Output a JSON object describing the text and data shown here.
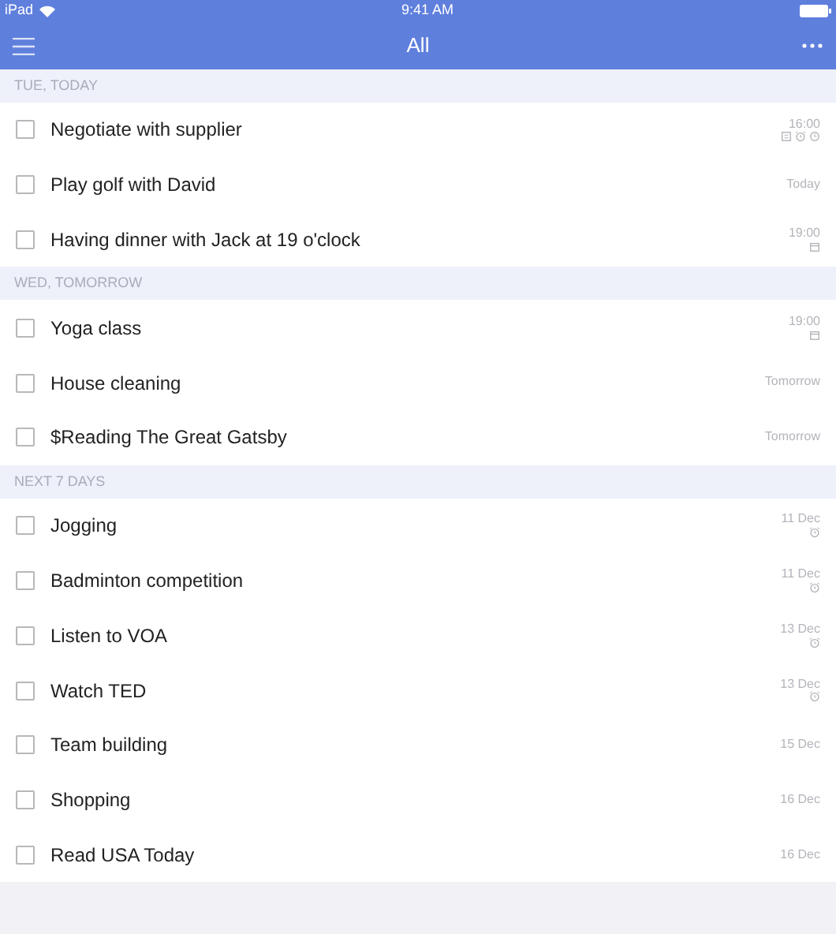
{
  "status_bar": {
    "device": "iPad",
    "time": "9:41 AM"
  },
  "nav": {
    "title": "All"
  },
  "sections": [
    {
      "header": "TUE, TODAY",
      "tasks": [
        {
          "title": "Negotiate with supplier",
          "checked": false,
          "due": "16:00",
          "icons": [
            {
              "kind": "note"
            },
            {
              "kind": "alarm"
            },
            {
              "kind": "clock"
            }
          ]
        },
        {
          "title": "Play golf with David",
          "checked": false,
          "due": "Today"
        },
        {
          "title": "Having dinner with Jack at 19 o'clock",
          "checked": false,
          "due": "19:00",
          "icons": [
            {
              "kind": "calendar"
            }
          ]
        }
      ]
    },
    {
      "header": "WED, TOMORROW",
      "tasks": [
        {
          "title": "Yoga class",
          "checked": false,
          "due": "19:00",
          "icons": [
            {
              "kind": "calendar"
            }
          ]
        },
        {
          "title": "House cleaning",
          "checked": false,
          "due": "Tomorrow"
        },
        {
          "title": "$Reading The Great Gatsby",
          "checked": false,
          "due": "Tomorrow"
        }
      ]
    },
    {
      "header": "NEXT 7 DAYS",
      "tasks": [
        {
          "title": "Jogging",
          "checked": false,
          "due": "11 Dec",
          "icons": [
            {
              "kind": "alarm"
            }
          ]
        },
        {
          "title": "Badminton competition",
          "checked": false,
          "due": "11 Dec",
          "icons": [
            {
              "kind": "alarm"
            }
          ]
        },
        {
          "title": "Listen to VOA",
          "checked": false,
          "due": "13 Dec",
          "icons": [
            {
              "kind": "alarm"
            }
          ]
        },
        {
          "title": "Watch TED",
          "checked": false,
          "due": "13 Dec",
          "icons": [
            {
              "kind": "alarm"
            }
          ]
        },
        {
          "title": "Team building",
          "checked": false,
          "due": "15 Dec"
        },
        {
          "title": "Shopping",
          "checked": false,
          "due": "16 Dec"
        },
        {
          "title": "Read USA Today",
          "checked": false,
          "due": "16 Dec"
        }
      ]
    }
  ]
}
